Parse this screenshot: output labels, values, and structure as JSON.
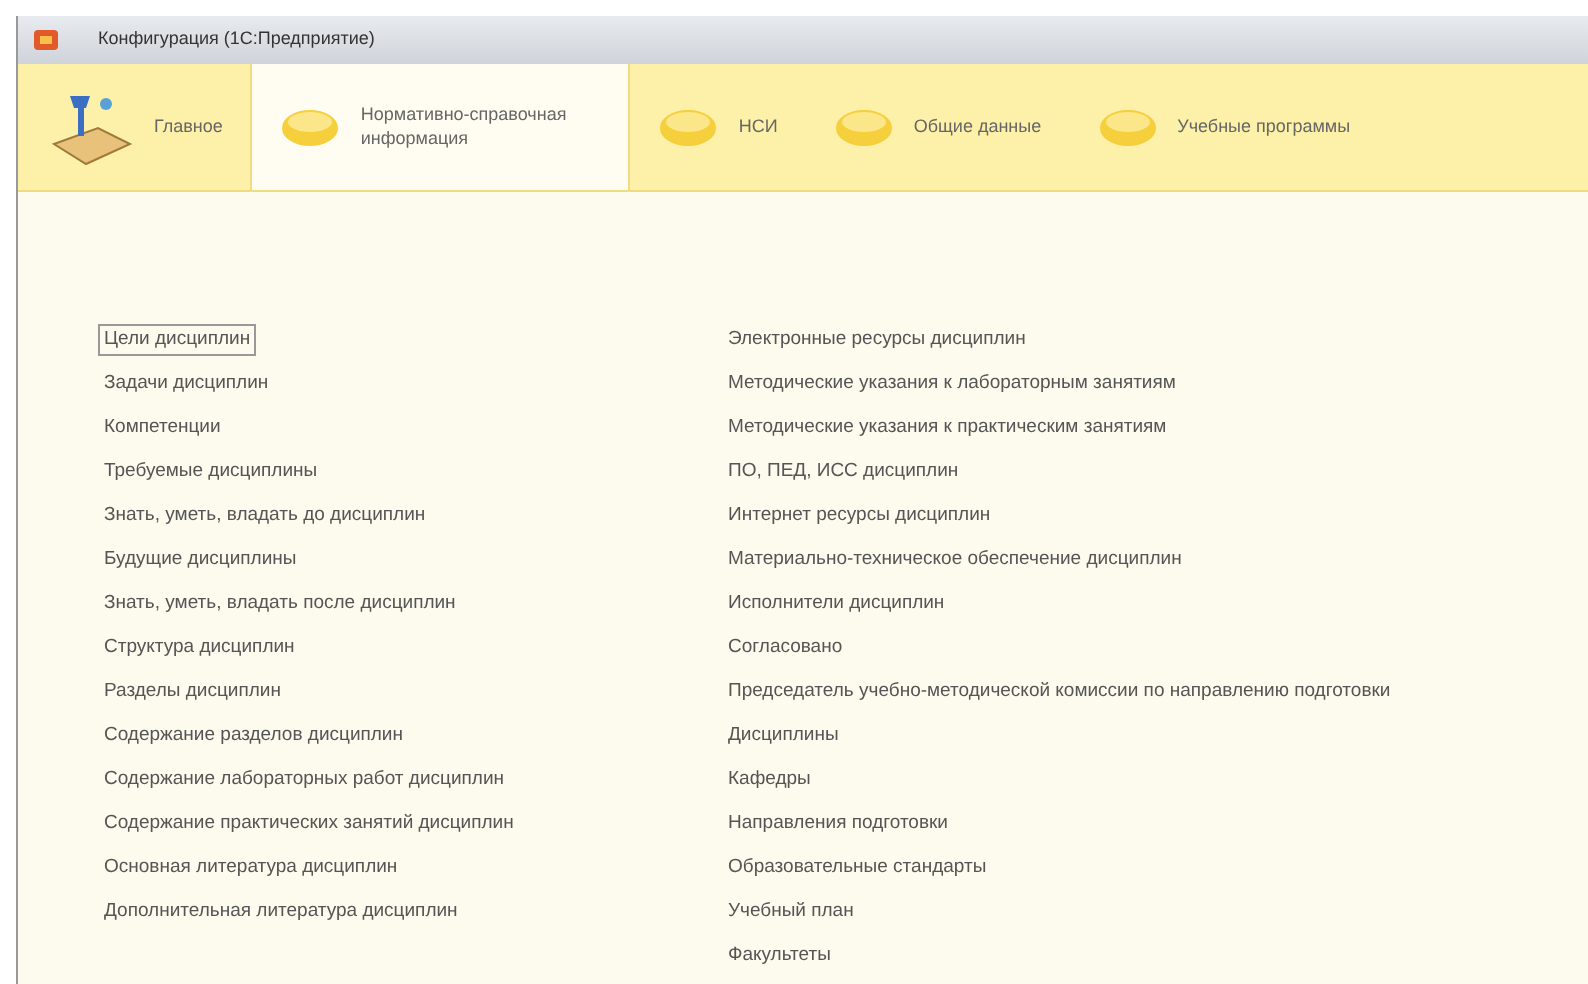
{
  "window": {
    "title": "Конфигурация (1С:Предприятие)"
  },
  "sections": [
    {
      "label": "Главное",
      "kind": "desk",
      "selected": false
    },
    {
      "label": "Нормативно-справочная информация",
      "kind": "disc",
      "selected": true
    },
    {
      "label": "НСИ",
      "kind": "disc",
      "selected": false
    },
    {
      "label": "Общие данные",
      "kind": "disc",
      "selected": false
    },
    {
      "label": "Учебные программы",
      "kind": "disc",
      "selected": false
    }
  ],
  "columns": [
    {
      "items": [
        {
          "label": "Цели дисциплин",
          "selected": true
        },
        {
          "label": "Задачи дисциплин",
          "selected": false
        },
        {
          "label": "Компетенции",
          "selected": false
        },
        {
          "label": "Требуемые дисциплины",
          "selected": false
        },
        {
          "label": "Знать, уметь, владать до дисциплин",
          "selected": false
        },
        {
          "label": "Будущие дисциплины",
          "selected": false
        },
        {
          "label": "Знать, уметь, владать после дисциплин",
          "selected": false
        },
        {
          "label": "Структура дисциплин",
          "selected": false
        },
        {
          "label": "Разделы дисциплин",
          "selected": false
        },
        {
          "label": "Содержание разделов дисциплин",
          "selected": false
        },
        {
          "label": "Содержание лабораторных работ дисциплин",
          "selected": false
        },
        {
          "label": "Содержание практических занятий дисциплин",
          "selected": false
        },
        {
          "label": "Основная литература дисциплин",
          "selected": false
        },
        {
          "label": "Дополнительная литература дисциплин",
          "selected": false
        }
      ]
    },
    {
      "items": [
        {
          "label": "Электронные ресурсы дисциплин",
          "selected": false
        },
        {
          "label": "Методические указания к лабораторным занятиям",
          "selected": false
        },
        {
          "label": "Методические указания к практическим занятиям",
          "selected": false
        },
        {
          "label": "ПО, ПЕД, ИСС дисциплин",
          "selected": false
        },
        {
          "label": "Интернет ресурсы дисциплин",
          "selected": false
        },
        {
          "label": "Материально-техническое обеспечение дисциплин",
          "selected": false
        },
        {
          "label": "Исполнители дисциплин",
          "selected": false
        },
        {
          "label": "Согласовано",
          "selected": false
        },
        {
          "label": "Председатель учебно-методической комиссии по направлению подготовки",
          "selected": false
        },
        {
          "label": "Дисциплины",
          "selected": false
        },
        {
          "label": "Кафедры",
          "selected": false
        },
        {
          "label": "Направления подготовки",
          "selected": false
        },
        {
          "label": "Образовательные стандарты",
          "selected": false
        },
        {
          "label": "Учебный план",
          "selected": false
        },
        {
          "label": "Факультеты",
          "selected": false
        }
      ]
    }
  ]
}
